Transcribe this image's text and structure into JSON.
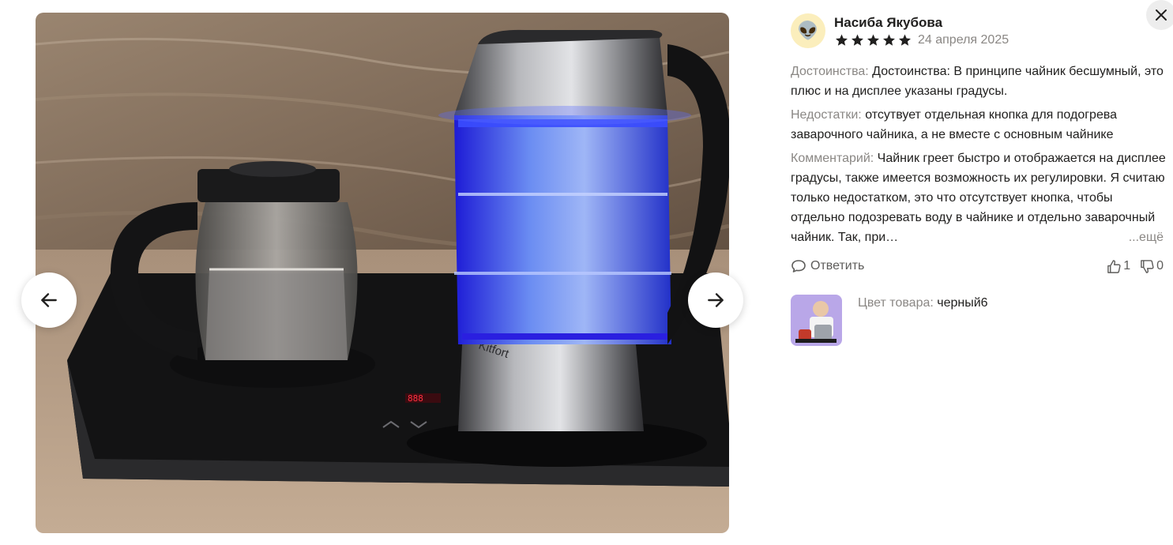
{
  "gallery": {
    "photo_alt": "Фото из отзыва",
    "prev_label": "Предыдущее фото",
    "next_label": "Следующее фото",
    "product_brand_on_photo": "Kitfort",
    "icons": {
      "prev": "arrow-left-icon",
      "next": "arrow-right-icon"
    }
  },
  "review": {
    "author": {
      "name": "Насиба Якубова",
      "avatar_emoji": "👽"
    },
    "rating": 5,
    "rating_max": 5,
    "date": "24 апреля 2025",
    "pros": {
      "label": "Достоинства:",
      "text": " Достоинства: В принципе чайник бесшумный, это плюс и на дисплее указаны градусы."
    },
    "cons": {
      "label": "Недостатки:",
      "text": " отсутвует отдельная кнопка для подогрева заварочного чайника, а не вместе с основным чайнике"
    },
    "comment": {
      "label": "Комментарий:",
      "text": " Чайник греет быстро и отображается на дисплее градусы, также имеется возможность их регулировки. Я считаю только недостатком, это что отсутствует кнопка, чтобы отдельно подозревать воду в чайнике и отдельно заварочный чайник. Так, при…",
      "more": "...ещё"
    },
    "actions": {
      "reply": "Ответить",
      "likes": "1",
      "dislikes": "0"
    },
    "product": {
      "variant_label": "Цвет товара:",
      "variant_value": " черный6"
    }
  },
  "colors": {
    "star": "#ffb800",
    "muted_text": "#8a8784",
    "text": "#21201f",
    "close_bg": "#ededed"
  },
  "close_label": "Закрыть"
}
